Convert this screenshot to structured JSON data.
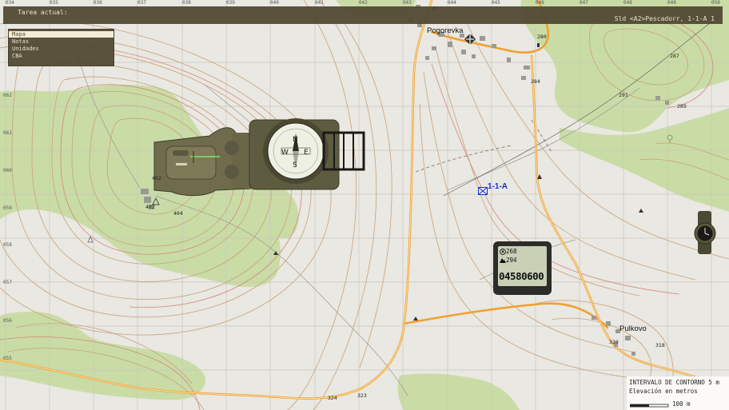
{
  "top_bar": {
    "task_label": "Tarea actual:",
    "unit_info": "Sld <A2>Pescadorr, 1-1-A 1"
  },
  "menu": {
    "items": [
      {
        "label": "Mapa",
        "selected": true
      },
      {
        "label": "Notas",
        "selected": false
      },
      {
        "label": "Unidades",
        "selected": false
      },
      {
        "label": "CBA",
        "selected": false
      }
    ]
  },
  "grid": {
    "x_labels": [
      "034",
      "035",
      "036",
      "037",
      "038",
      "039",
      "040",
      "041",
      "042",
      "043",
      "044",
      "045",
      "046",
      "047",
      "048",
      "049",
      "050"
    ],
    "y_labels": [
      "062",
      "061",
      "060",
      "059",
      "058",
      "057",
      "056",
      "055"
    ]
  },
  "towns": {
    "north": "Pogorevka",
    "south": "Pulkovo"
  },
  "heights": [
    "402",
    "402",
    "404",
    "280",
    "284",
    "291",
    "287",
    "289",
    "320",
    "318",
    "324",
    "323"
  ],
  "group_marker": {
    "label": "1-1-A"
  },
  "gps": {
    "heading": "268",
    "altitude": "294",
    "grid_ref": "04580600"
  },
  "legend": {
    "contour_interval": "INTERVALO DE CONTORNO 5 m",
    "elevation_units": "Elevación en metros",
    "scale": "100 m"
  },
  "colors": {
    "map_background": "#e9e8e2",
    "forest": "#c9dca6",
    "road": "#f0a030",
    "contour": "#c9a17c",
    "grid": "#c9c7bd",
    "ui_panel": "#4e4430",
    "group_marker": "#1a2ec8"
  }
}
